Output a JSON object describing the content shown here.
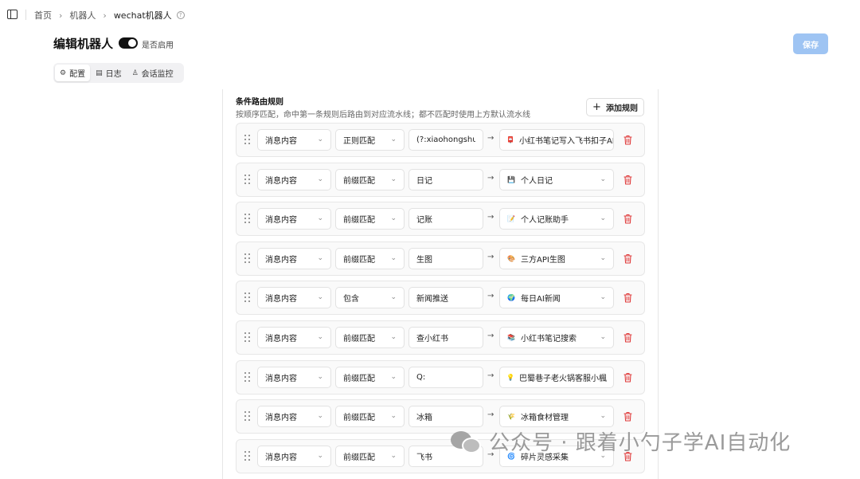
{
  "breadcrumb": {
    "home": "首页",
    "bots": "机器人",
    "current": "wechat机器人",
    "help": "?"
  },
  "header": {
    "title": "编辑机器人",
    "toggle_label": "是否启用",
    "save_label": "保存"
  },
  "tabs": [
    {
      "label": "配置",
      "icon": "gear-icon",
      "glyph": "⚙",
      "active": true
    },
    {
      "label": "日志",
      "icon": "file-icon",
      "glyph": "▤",
      "active": false
    },
    {
      "label": "会话监控",
      "icon": "users-icon",
      "glyph": "♙",
      "active": false
    }
  ],
  "routing": {
    "title": "条件路由规则",
    "description": "按顺序匹配，命中第一条规则后路由到对应流水线；都不匹配时使用上方默认流水线",
    "add_label": "添加规则",
    "rules": [
      {
        "field": "消息内容",
        "match": "正则匹配",
        "value": "(?:xiaohongshu\\.",
        "target": "小红书笔记写入飞书扣子API",
        "emoji": "📮",
        "emoji_color": "#d94a4a"
      },
      {
        "field": "消息内容",
        "match": "前缀匹配",
        "value": "日记",
        "target": "个人日记",
        "emoji": "💾",
        "emoji_color": "#4a5a8a"
      },
      {
        "field": "消息内容",
        "match": "前缀匹配",
        "value": "记账",
        "target": "个人记账助手",
        "emoji": "📝",
        "emoji_color": "#d8b060"
      },
      {
        "field": "消息内容",
        "match": "前缀匹配",
        "value": "生图",
        "target": "三方API生图",
        "emoji": "🎨",
        "emoji_color": "#c98a3a"
      },
      {
        "field": "消息内容",
        "match": "包含",
        "value": "新闻推送",
        "target": "每日AI新闻",
        "emoji": "🌍",
        "emoji_color": "#3a8ac9"
      },
      {
        "field": "消息内容",
        "match": "前缀匹配",
        "value": "查小红书",
        "target": "小红书笔记搜索",
        "emoji": "📚",
        "emoji_color": "#6a7a4a"
      },
      {
        "field": "消息内容",
        "match": "前缀匹配",
        "value": "Q:",
        "target": "巴蜀巷子老火锅客服小楓",
        "emoji": "💡",
        "emoji_color": "#e8c84a"
      },
      {
        "field": "消息内容",
        "match": "前缀匹配",
        "value": "冰箱",
        "target": "冰箱食材管理",
        "emoji": "🌾",
        "emoji_color": "#c9a84a"
      },
      {
        "field": "消息内容",
        "match": "前缀匹配",
        "value": "飞书",
        "target": "碎片灵感采集",
        "emoji": "🌀",
        "emoji_color": "#777777"
      }
    ]
  },
  "watermark": {
    "text": "公众号 · 跟着小勺子学AI自动化"
  },
  "colors": {
    "accent_disabled": "#9ec4f3",
    "delete_red": "#e03c3c",
    "toggle_on": "#111111"
  }
}
